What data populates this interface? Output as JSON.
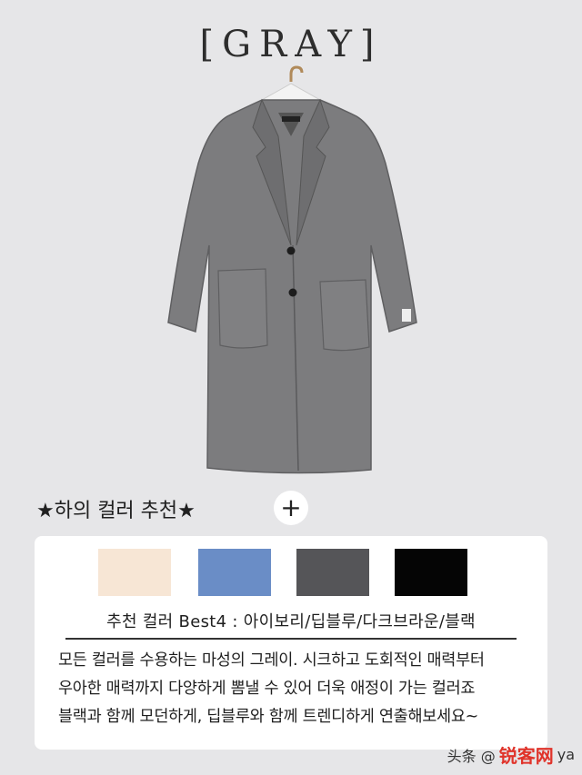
{
  "header": {
    "title": "[GRAY]"
  },
  "product": {
    "image_alt": "gray long coat",
    "color": "#7b7b7d"
  },
  "recommend": {
    "heading": "★하의 컬러 추천★",
    "plus_label": "+",
    "swatches": [
      {
        "name": "ivory",
        "color": "#f7e6d5"
      },
      {
        "name": "deep-blue",
        "color": "#6a8dc6"
      },
      {
        "name": "dark-gray",
        "color": "#555558"
      },
      {
        "name": "black",
        "color": "#050505"
      }
    ],
    "best_line": "추천 컬러 Best4 : 아이보리/딥블루/다크브라운/블랙",
    "description": [
      "모든 컬러를 수용하는 마성의 그레이. 시크하고 도회적인 매력부터",
      "우아한 매력까지 다양하게 뽐낼 수 있어 더욱 애정이 가는 컬러죠",
      "블랙과 함께 모던하게, 딥블루와 함께 트렌디하게 연출해보세요~"
    ]
  },
  "watermark": {
    "prefix": "头条 @",
    "brand": "锐客网",
    "suffix": "ya"
  }
}
